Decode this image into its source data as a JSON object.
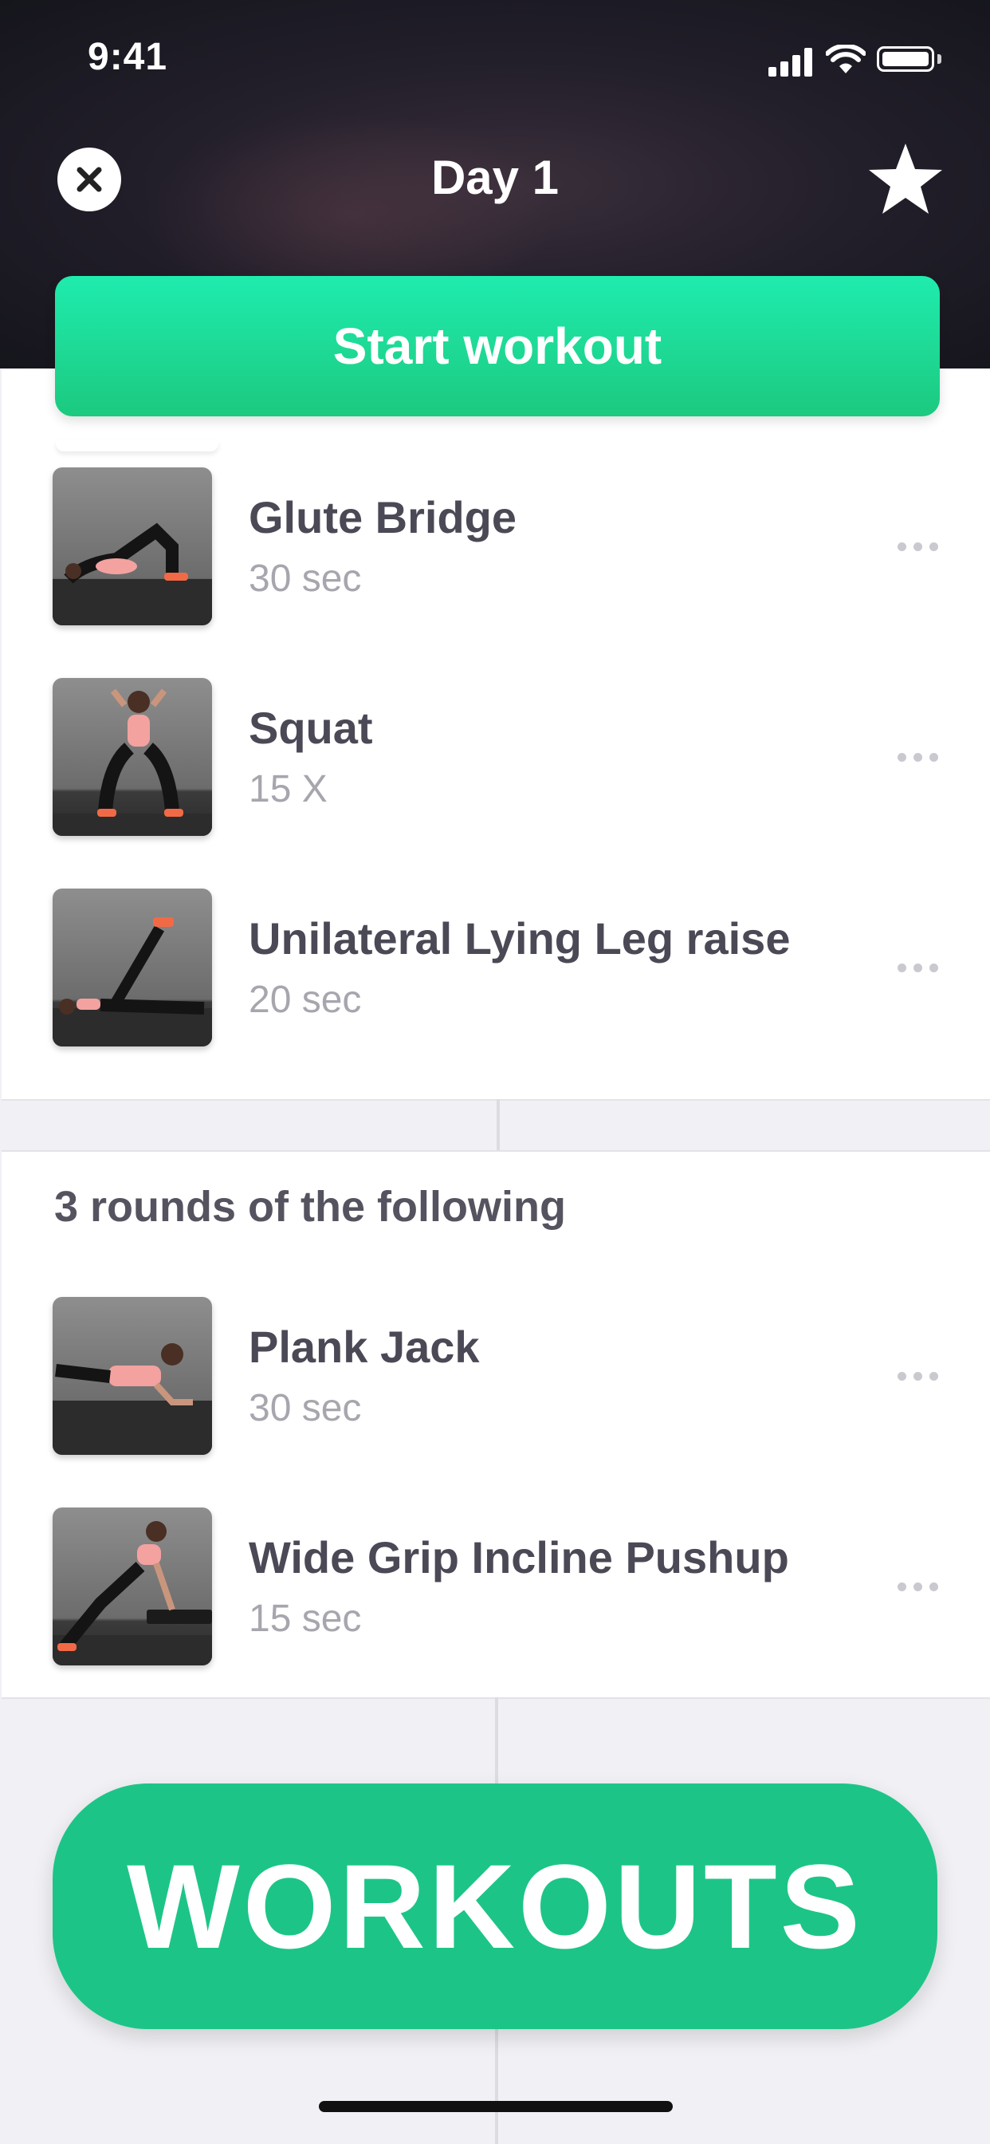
{
  "status_bar": {
    "time": "9:41"
  },
  "header": {
    "title": "Day 1",
    "close_icon": "close-icon",
    "star_icon": "star-icon"
  },
  "start_button": {
    "label": "Start workout"
  },
  "sections": [
    {
      "exercises": [
        {
          "name": "Glute Bridge",
          "meta": "30 sec"
        },
        {
          "name": "Squat",
          "meta": "15 X"
        },
        {
          "name": "Unilateral Lying Leg raise",
          "meta": "20 sec"
        }
      ]
    },
    {
      "title": "3 rounds of the following",
      "exercises": [
        {
          "name": "Plank Jack",
          "meta": "30 sec"
        },
        {
          "name": "Wide Grip Incline Pushup",
          "meta": "15 sec"
        }
      ]
    }
  ],
  "workouts_button": {
    "label": "WORKOUTS"
  },
  "colors": {
    "accent": "#1cc587",
    "accent_light": "#1fecae",
    "text": "#4b4955",
    "muted": "#a7a6ae"
  }
}
